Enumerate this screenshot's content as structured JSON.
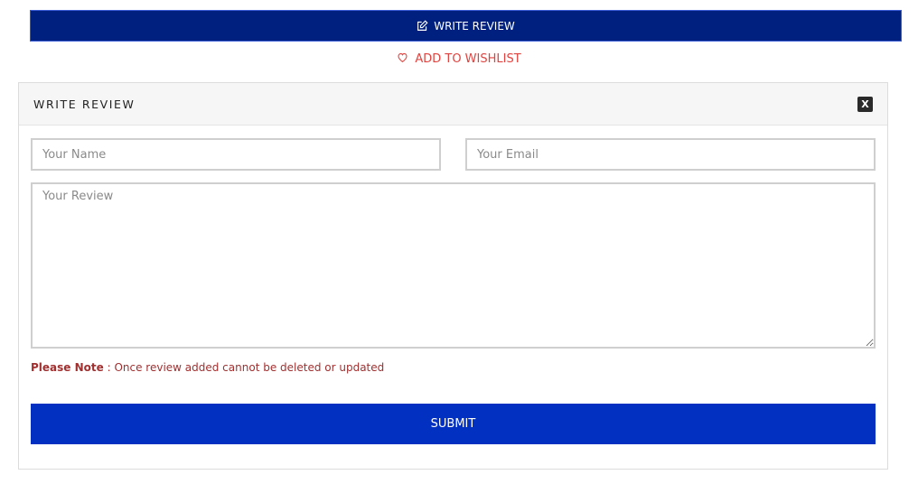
{
  "top_button": {
    "label": "WRITE REVIEW",
    "icon": "edit-icon"
  },
  "wishlist": {
    "label": "ADD TO WISHLIST",
    "icon": "heart-outline-icon"
  },
  "review_panel": {
    "title": "WRITE REVIEW",
    "close_label": "X",
    "name_placeholder": "Your Name",
    "email_placeholder": "Your Email",
    "review_placeholder": "Your Review",
    "note_label": "Please Note",
    "note_text": " : Once review added cannot be deleted or updated",
    "submit_label": "SUBMIT"
  },
  "colors": {
    "top_button_bg": "#00207f",
    "submit_bg": "#0230c0",
    "wishlist_text": "#e0433f",
    "note_text": "#a13030"
  }
}
